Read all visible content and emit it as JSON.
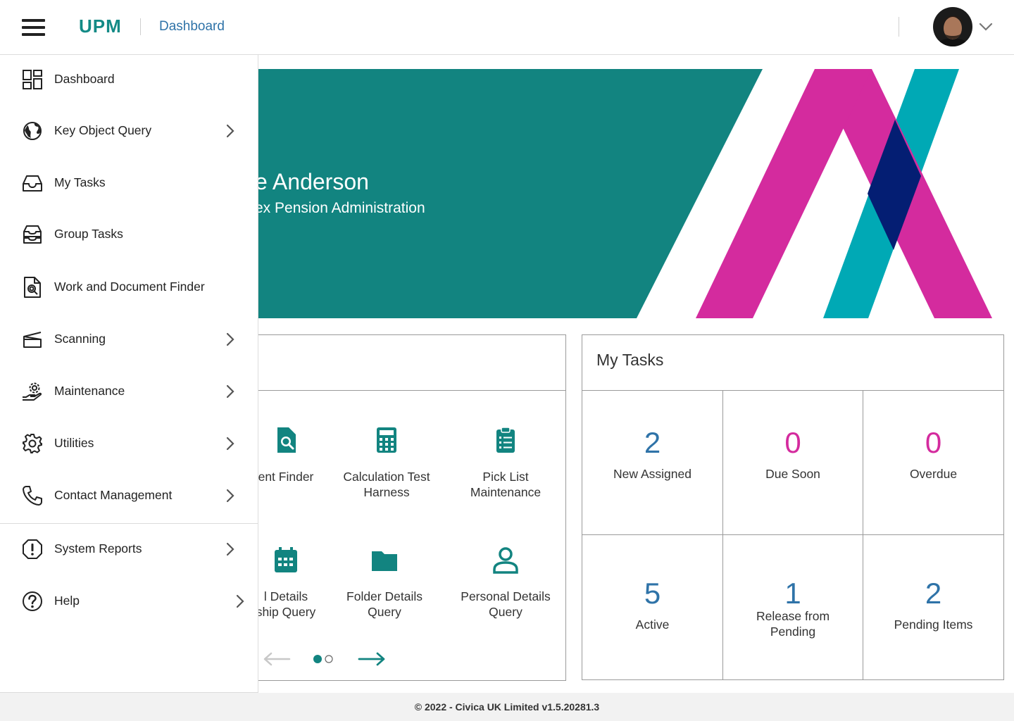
{
  "header": {
    "brand": "UPM",
    "breadcrumb": "Dashboard"
  },
  "banner": {
    "name_visible": "e Anderson",
    "org_visible": "ex Pension Administration",
    "colors": {
      "teal": "#128480",
      "magenta": "#d42b9e",
      "cyan": "#00a9b5",
      "navy": "#041e73"
    }
  },
  "menu": {
    "items": [
      {
        "label": "Dashboard",
        "icon": "dashboard-icon",
        "has_submenu": false
      },
      {
        "label": "Key Object Query",
        "icon": "globe-icon",
        "has_submenu": true
      },
      {
        "label": "My Tasks",
        "icon": "inbox-icon",
        "has_submenu": false
      },
      {
        "label": "Group Tasks",
        "icon": "stacked-inbox-icon",
        "has_submenu": false
      },
      {
        "label": "Work and Document Finder",
        "icon": "document-search-icon",
        "has_submenu": false
      },
      {
        "label": "Scanning",
        "icon": "scanner-icon",
        "has_submenu": true
      },
      {
        "label": "Maintenance",
        "icon": "hand-gear-icon",
        "has_submenu": true
      },
      {
        "label": "Utilities",
        "icon": "gear-icon",
        "has_submenu": true
      },
      {
        "label": "Contact Management",
        "icon": "phone-icon",
        "has_submenu": true
      },
      {
        "label": "System Reports",
        "icon": "alert-octagon-icon",
        "has_submenu": true
      },
      {
        "label": "Help",
        "icon": "help-circle-icon",
        "has_submenu": true
      }
    ]
  },
  "quick_access": {
    "items": [
      {
        "line1": "ent Finder",
        "line2": "",
        "icon": "document-search-icon"
      },
      {
        "line1": "Calculation Test",
        "line2": "Harness",
        "icon": "calculator-icon"
      },
      {
        "line1": "Pick List",
        "line2": "Maintenance",
        "icon": "clipboard-list-icon"
      },
      {
        "line1": "l Details",
        "line2": "ship Query",
        "icon": "calendar-icon"
      },
      {
        "line1": "Folder Details",
        "line2": "Query",
        "icon": "folder-icon"
      },
      {
        "line1": "Personal Details",
        "line2": "Query",
        "icon": "person-icon"
      }
    ],
    "page": {
      "current": 1,
      "total": 2
    }
  },
  "my_tasks": {
    "title": "My Tasks",
    "cells": [
      {
        "count": "2",
        "label": "New Assigned",
        "label2": "",
        "color": "#2f73a8"
      },
      {
        "count": "0",
        "label": "Due Soon",
        "label2": "",
        "color": "#d42b9e"
      },
      {
        "count": "0",
        "label": "Overdue",
        "label2": "",
        "color": "#d42b9e"
      },
      {
        "count": "5",
        "label": "Active",
        "label2": "",
        "color": "#2f73a8"
      },
      {
        "count": "1",
        "label": "Release from",
        "label2": "Pending",
        "color": "#2f73a8"
      },
      {
        "count": "2",
        "label": "Pending Items",
        "label2": "",
        "color": "#2f73a8"
      }
    ]
  },
  "footer": {
    "text": "© 2022 - Civica UK Limited v1.5.20281.3"
  }
}
